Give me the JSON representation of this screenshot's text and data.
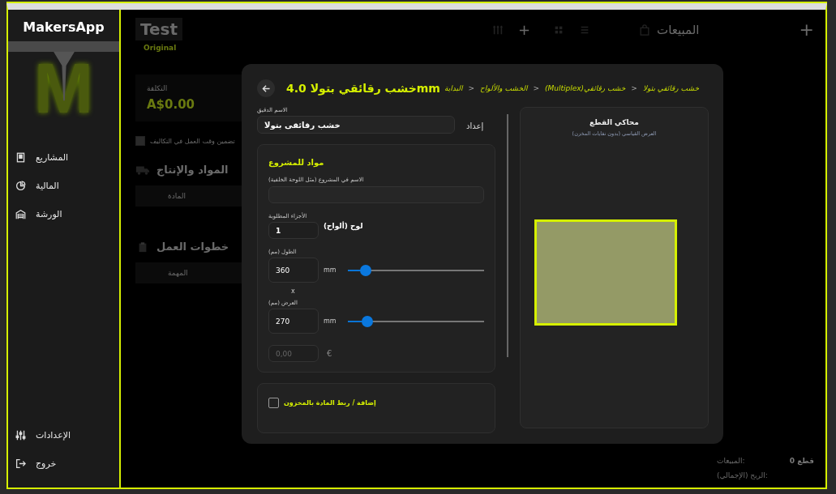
{
  "app": {
    "name": "MakersApp",
    "logo_mark": "M"
  },
  "sidebar": {
    "items": [
      {
        "label": "المشاريع",
        "kind": "projects"
      },
      {
        "label": "المالية",
        "kind": "finance"
      },
      {
        "label": "الورشة",
        "kind": "workshop"
      }
    ],
    "footer_items": [
      {
        "label": "الإعدادات",
        "kind": "settings"
      },
      {
        "label": "خروج",
        "kind": "logout"
      }
    ]
  },
  "background": {
    "project_title": "Test",
    "project_subtitle": "Original",
    "cost_label": "التكلفة",
    "cost_value": "A$0.00",
    "include_labor": {
      "label": "تضمين وقت العمل في التكاليف",
      "checked": true
    },
    "materials_heading": "المواد والإنتاج",
    "materials_column": "المادة",
    "steps_heading": "خطوات العمل",
    "steps_column": "المهمة",
    "sales_heading": "المبيعات",
    "add_symbol": "+",
    "toolbar_add_symbol": "+",
    "summary": [
      {
        "label": "المبيعات:",
        "value": "قطع 0"
      },
      {
        "label": "الربح (الإجمالي):"
      }
    ]
  },
  "dialog": {
    "title": "mmخشب رقائقي بتولا 4.0",
    "breadcrumb": [
      {
        "label": "خشب رقائقي بتولا"
      },
      {
        "label": "خشب رقائقي(Multiplex)"
      },
      {
        "label": "الخشب والألواح"
      },
      {
        "label": "البداية"
      }
    ],
    "breadcrumb_separator": "<",
    "exact_name": {
      "label": "الاسم الدقيق",
      "value": "خشب رقائقي بتولا"
    },
    "setup_label": "إعداد",
    "project_material": {
      "title": "مواد للمشروع",
      "name_label": "الاسم في المشروع (مثل اللوحة الخلفية)",
      "parts_label": "الأجزاء المطلوبة",
      "parts_value": "1",
      "parts_unit": "لوح (ألواح)",
      "length": {
        "label": "الطول (مم)",
        "value": "360",
        "unit": "mm",
        "level": 0.13
      },
      "times_symbol": "x",
      "width": {
        "label": "العرض (مم)",
        "value": "270",
        "unit": "mm",
        "level": 0.14
      },
      "price_placeholder": "0,00",
      "currency": "€"
    },
    "stock_link": {
      "label": "إضافة / ربط المادة بالمخزون",
      "checked": false
    },
    "simulator": {
      "title": "محاكي القطع",
      "subtitle": "العرض القياسي (بدون نفايات المخزن)"
    }
  }
}
